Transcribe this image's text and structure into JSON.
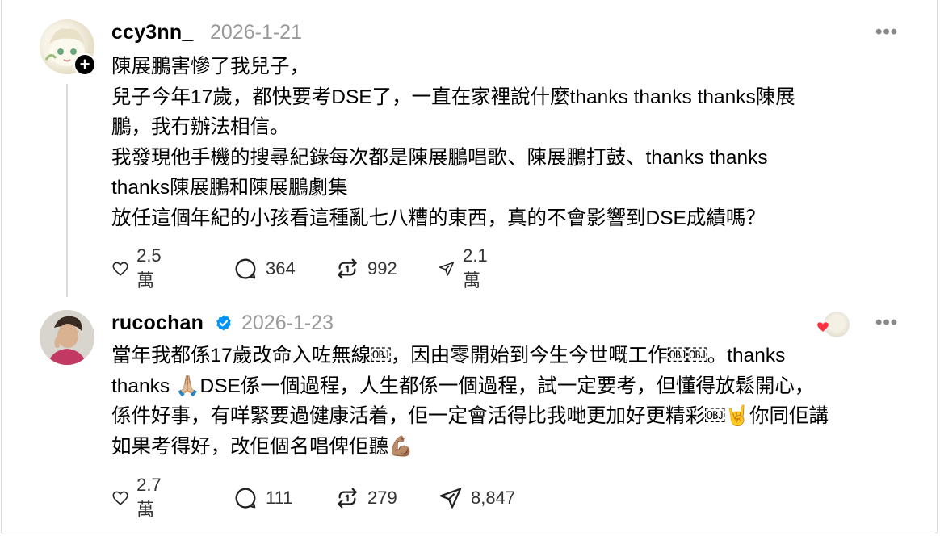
{
  "posts": [
    {
      "username": "ccy3nn_",
      "date": "2026-1-21",
      "avatar_icon": "anime-character-avatar",
      "follow_badge": "+",
      "text": "陳展鵬害慘了我兒子，\n兒子今年17歲，都快要考DSE了，一直在家裡說什麼thanks thanks thanks陳展\n鵬，我冇辦法相信。\n我發現他手機的搜尋紀錄每次都是陳展鵬唱歌、陳展鵬打鼓、thanks thanks\nthanks陳展鵬和陳展鵬劇集\n放任這個年紀的小孩看這種亂七八糟的東西，真的不會影響到DSE成績嗎？",
      "likes": "2.5 萬",
      "comments": "364",
      "reposts": "992",
      "shares": "2.1 萬"
    },
    {
      "username": "rucochan",
      "date": "2026-1-23",
      "avatar_icon": "man-profile-avatar",
      "verified_icon": "verified-badge-icon",
      "text": "當年我都係17歲改命入咗無線￼，因由零開始到今生今世嘅工作￼￼。thanks\nthanks 🙏🏼DSE係一個過程，人生都係一個過程，試一定要考，但懂得放鬆開心，\n係件好事，有咩緊要過健康活着，佢一定會活得比我哋更加好更精彩￼🤘你同佢講\n如果考得好，改佢個名唱俾佢聽💪🏽",
      "likes": "2.7 萬",
      "comments": "111",
      "reposts": "279",
      "shares": "8,847"
    }
  ],
  "more_label": "•••",
  "colors": {
    "muted": "#999999",
    "verified": "#0095f6",
    "heart": "#ff3040"
  }
}
